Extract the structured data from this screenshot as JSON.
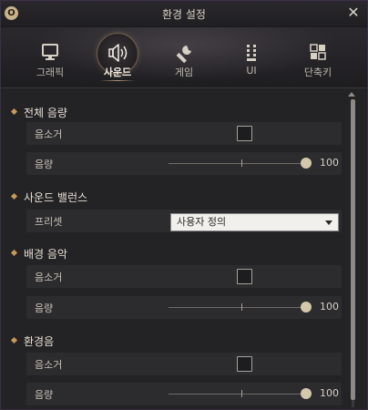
{
  "window": {
    "title": "환경 설정",
    "badge": "O"
  },
  "tabs": [
    {
      "label": "그래픽",
      "icon": "monitor-icon",
      "active": false
    },
    {
      "label": "사운드",
      "icon": "speaker-icon",
      "active": true
    },
    {
      "label": "게임",
      "icon": "wrench-icon",
      "active": false
    },
    {
      "label": "UI",
      "icon": "ui-grid-icon",
      "active": false
    },
    {
      "label": "단축키",
      "icon": "shortcut-icon",
      "active": false
    }
  ],
  "sections": {
    "master": {
      "title": "전체 음량",
      "mute_label": "음소거",
      "mute_checked": false,
      "volume_label": "음량",
      "volume_value": "100"
    },
    "balance": {
      "title": "사운드 밸런스",
      "preset_label": "프리셋",
      "preset_value": "사용자 정의"
    },
    "bgm": {
      "title": "배경 음악",
      "mute_label": "음소거",
      "mute_checked": false,
      "volume_label": "음량",
      "volume_value": "100"
    },
    "ambient": {
      "title": "환경음",
      "mute_label": "음소거",
      "mute_checked": false,
      "volume_label": "음량",
      "volume_value": "100"
    }
  },
  "colors": {
    "accent": "#c99a55",
    "panel_bg": "#232225",
    "row_bg": "#2c2b2e",
    "border": "#3a3048"
  }
}
